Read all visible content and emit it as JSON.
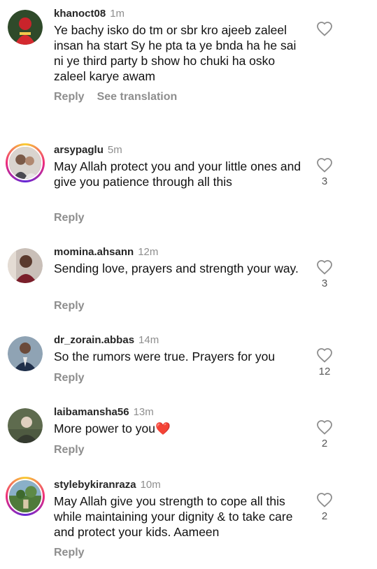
{
  "comments": [
    {
      "username": "khanoct08",
      "time": "1m",
      "text": "Ye bachy isko do tm or sbr kro ajeeb zaleel insan ha start Sy he pta ta ye bnda ha he sai ni ye third party b show ho chuki ha osko zaleel karye awam",
      "reply": "Reply",
      "translate": "See translation",
      "likes": ""
    },
    {
      "username": "arsypaglu",
      "time": "5m",
      "text": "May Allah protect you and your little ones and give you patience through all this",
      "reply": "Reply",
      "likes": "3"
    },
    {
      "username": "momina.ahsann",
      "time": "12m",
      "text": "Sending love, prayers and strength your way.",
      "reply": "Reply",
      "likes": "3"
    },
    {
      "username": "dr_zorain.abbas",
      "time": "14m",
      "text": "So the rumors were true. Prayers for you",
      "reply": "Reply",
      "likes": "12"
    },
    {
      "username": "laibamansha56",
      "time": "13m",
      "text": "More power to you",
      "emoji": "❤️",
      "reply": "Reply",
      "likes": "2"
    },
    {
      "username": "stylebykiranraza",
      "time": "10m",
      "text": "May Allah give you strength to cope all this while maintaining your dignity & to take care and protect your kids. Aameen",
      "reply": "Reply",
      "likes": "2"
    }
  ],
  "icons": {
    "like": "heart-outline-icon"
  },
  "colors": {
    "muted": "#8e8e8e",
    "story_ring": "#ee2a7b"
  }
}
